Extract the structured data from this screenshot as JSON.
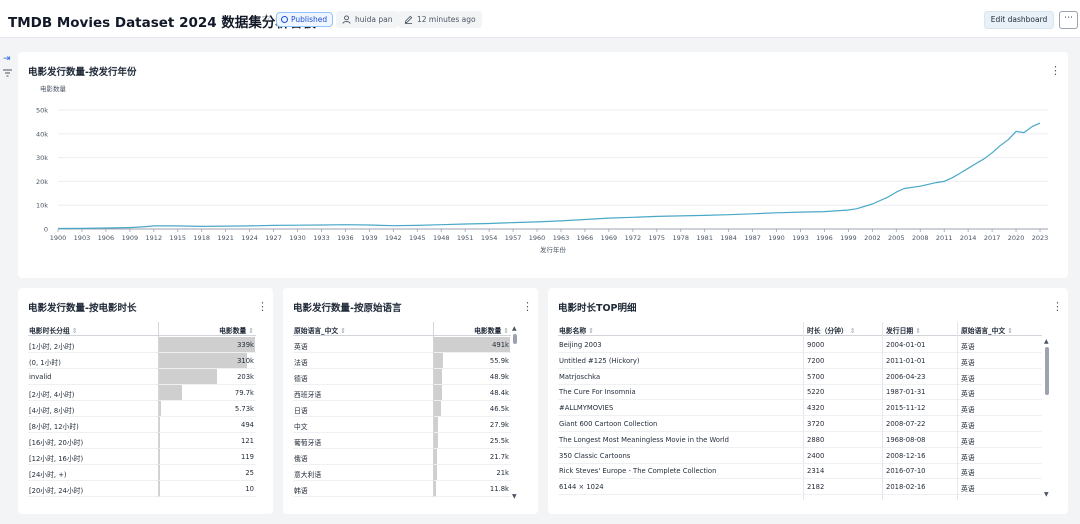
{
  "header": {
    "title": "TMDB Movies Dataset 2024 数据集分析看板",
    "status": "Published",
    "author": "huida pan",
    "updated": "12 minutes ago",
    "edit_label": "Edit dashboard",
    "more_label": "⋯"
  },
  "line_card": {
    "title": "电影发行数量-按发行年份",
    "menu": "⋮"
  },
  "chart_data": {
    "type": "line",
    "title": "电影发行数量-按发行年份",
    "ylabel": "电影数量",
    "xlabel": "发行年份",
    "ylim": [
      0,
      50000
    ],
    "y_ticks": [
      0,
      10000,
      20000,
      30000,
      40000,
      50000
    ],
    "y_tick_labels": [
      "0",
      "10k",
      "20k",
      "30k",
      "40k",
      "50k"
    ],
    "xlim": [
      1900,
      2024
    ],
    "x_ticks": [
      1900,
      1903,
      1906,
      1909,
      1912,
      1915,
      1918,
      1921,
      1924,
      1927,
      1930,
      1933,
      1936,
      1939,
      1942,
      1945,
      1948,
      1951,
      1954,
      1957,
      1960,
      1963,
      1966,
      1969,
      1972,
      1975,
      1978,
      1981,
      1984,
      1987,
      1990,
      1993,
      1996,
      1999,
      2002,
      2005,
      2008,
      2011,
      2014,
      2017,
      2020,
      2023
    ],
    "color": "#4aa8c7",
    "series": [
      {
        "x": [
          1900,
          1903,
          1906,
          1909,
          1911,
          1912,
          1915,
          1918,
          1921,
          1924,
          1927,
          1930,
          1933,
          1936,
          1939,
          1942,
          1945,
          1948,
          1951,
          1954,
          1957,
          1960,
          1963,
          1966,
          1969,
          1972,
          1975,
          1978,
          1981,
          1984,
          1987,
          1990,
          1993,
          1996,
          1999,
          2000,
          2002,
          2004,
          2005,
          2006,
          2008,
          2010,
          2011,
          2012,
          2013,
          2014,
          2015,
          2016,
          2017,
          2018,
          2019,
          2020,
          2021,
          2022,
          2023
        ],
        "y": [
          200,
          250,
          400,
          600,
          1000,
          1300,
          1300,
          1100,
          1200,
          1300,
          1500,
          1600,
          1700,
          1800,
          1700,
          1400,
          1500,
          1800,
          2100,
          2300,
          2700,
          3000,
          3400,
          4000,
          4600,
          4900,
          5300,
          5500,
          5700,
          6000,
          6400,
          6800,
          7100,
          7300,
          8000,
          8500,
          10500,
          13500,
          15500,
          17000,
          18000,
          19500,
          20000,
          21500,
          23500,
          25500,
          27500,
          29500,
          32000,
          35000,
          37500,
          41000,
          40500,
          43000,
          44500
        ]
      }
    ]
  },
  "dur_card": {
    "title": "电影发行数量-按电影时长",
    "menu": "⋮",
    "headers": [
      "电影时长分组",
      "电影数量"
    ],
    "max_bar": 339000,
    "rows": [
      {
        "label": "[1小时, 2小时)",
        "count": "339k",
        "value": 339000
      },
      {
        "label": "(0, 1小时)",
        "count": "310k",
        "value": 310000
      },
      {
        "label": "invalid",
        "count": "203k",
        "value": 203000
      },
      {
        "label": "[2小时, 4小时)",
        "count": "79.7k",
        "value": 79700
      },
      {
        "label": "[4小时, 8小时)",
        "count": "5.73k",
        "value": 5730
      },
      {
        "label": "[8小时, 12小时)",
        "count": "494",
        "value": 494
      },
      {
        "label": "[16小时, 20小时)",
        "count": "121",
        "value": 121
      },
      {
        "label": "[12小时, 16小时)",
        "count": "119",
        "value": 119
      },
      {
        "label": "[24小时, +)",
        "count": "25",
        "value": 25
      },
      {
        "label": "[20小时, 24小时)",
        "count": "10",
        "value": 10
      }
    ]
  },
  "lang_card": {
    "title": "电影发行数量-按原始语言",
    "menu": "⋮",
    "headers": [
      "原始语言_中文",
      "电影数量"
    ],
    "max_bar": 491000,
    "rows": [
      {
        "label": "英语",
        "count": "491k",
        "value": 491000
      },
      {
        "label": "法语",
        "count": "55.9k",
        "value": 55900
      },
      {
        "label": "德语",
        "count": "48.9k",
        "value": 48900
      },
      {
        "label": "西班牙语",
        "count": "48.4k",
        "value": 48400
      },
      {
        "label": "日语",
        "count": "46.5k",
        "value": 46500
      },
      {
        "label": "中文",
        "count": "27.9k",
        "value": 27900
      },
      {
        "label": "葡萄牙语",
        "count": "25.5k",
        "value": 25500
      },
      {
        "label": "俄语",
        "count": "21.7k",
        "value": 21700
      },
      {
        "label": "意大利语",
        "count": "21k",
        "value": 21000
      },
      {
        "label": "韩语",
        "count": "11.8k",
        "value": 11800
      }
    ]
  },
  "top_card": {
    "title": "电影时长TOP明细",
    "menu": "⋮",
    "headers": [
      "电影名称",
      "时长（分钟）",
      "发行日期",
      "原始语言_中文"
    ],
    "rows": [
      [
        "Beijing 2003",
        "9000",
        "2004-01-01",
        "英语"
      ],
      [
        "Untitled #125 (Hickory)",
        "7200",
        "2011-01-01",
        "英语"
      ],
      [
        "Matrjoschka",
        "5700",
        "2006-04-23",
        "英语"
      ],
      [
        "The Cure For Insomnia",
        "5220",
        "1987-01-31",
        "英语"
      ],
      [
        "#ALLMYMOVIES",
        "4320",
        "2015-11-12",
        "英语"
      ],
      [
        "Giant 600 Cartoon Collection",
        "3720",
        "2008-07-22",
        "英语"
      ],
      [
        "The Longest Most Meaningless Movie in the World",
        "2880",
        "1968-08-08",
        "英语"
      ],
      [
        "350 Classic Cartoons",
        "2400",
        "2008-12-16",
        "英语"
      ],
      [
        "Rick Steves' Europe - The Complete Collection",
        "2314",
        "2016-07-10",
        "英语"
      ],
      [
        "6144 × 1024",
        "2182",
        "2018-02-16",
        "英语"
      ]
    ]
  }
}
